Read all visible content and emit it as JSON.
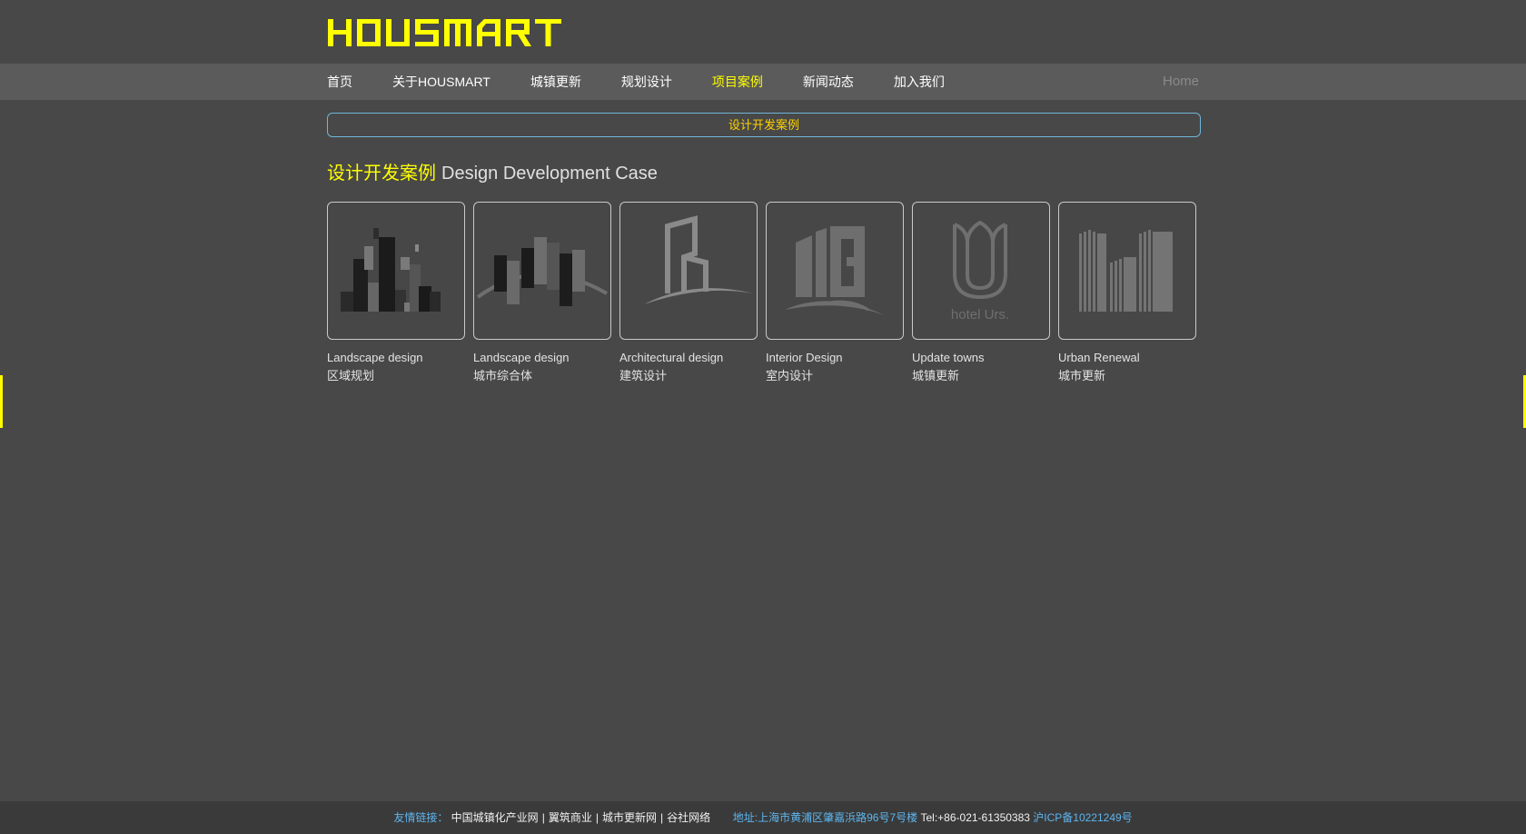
{
  "brand": {
    "logo_text": "HOUSMART",
    "color": "#ffff00"
  },
  "nav": {
    "items": [
      {
        "label": "首页",
        "active": false
      },
      {
        "label": "关于HOUSMART",
        "active": false
      },
      {
        "label": "城镇更新",
        "active": false
      },
      {
        "label": "规划设计",
        "active": false
      },
      {
        "label": "项目案例",
        "active": true
      },
      {
        "label": "新闻动态",
        "active": false
      },
      {
        "label": "加入我们",
        "active": false
      }
    ],
    "home_label": "Home"
  },
  "tab": {
    "label": "设计开发案例"
  },
  "section": {
    "title_cn": "设计开发案例",
    "title_en": "Design Development Case"
  },
  "cards": [
    {
      "icon": "skyline-blocks-icon",
      "title_en": "Landscape design",
      "title_cn": "区域规划"
    },
    {
      "icon": "skyline-arc-icon",
      "title_en": "Landscape design",
      "title_cn": "城市综合体"
    },
    {
      "icon": "tower-b-icon",
      "title_en": "Architectural design",
      "title_cn": "建筑设计"
    },
    {
      "icon": "building-g-icon",
      "title_en": "Interior Design",
      "title_cn": "室内设计"
    },
    {
      "icon": "hotel-urs-icon",
      "title_en": "Update towns",
      "title_cn": "城镇更新",
      "logo_caption": "hotel Urs."
    },
    {
      "icon": "urban-bars-icon",
      "title_en": "Urban Renewal",
      "title_cn": "城市更新"
    }
  ],
  "footer": {
    "links_label": "友情链接：",
    "links": [
      "中国城镇化产业网",
      "翼筑商业",
      "城市更新网",
      "谷社网络"
    ],
    "address": "地址:上海市黄浦区肇嘉浜路96号7号楼",
    "tel": "Tel:+86-021-61350383",
    "icp": "沪ICP备10221249号"
  },
  "colors": {
    "accent": "#ffff00",
    "link_blue": "#5db5ef",
    "border_blue": "#6fb6d9",
    "background": "#484848"
  }
}
